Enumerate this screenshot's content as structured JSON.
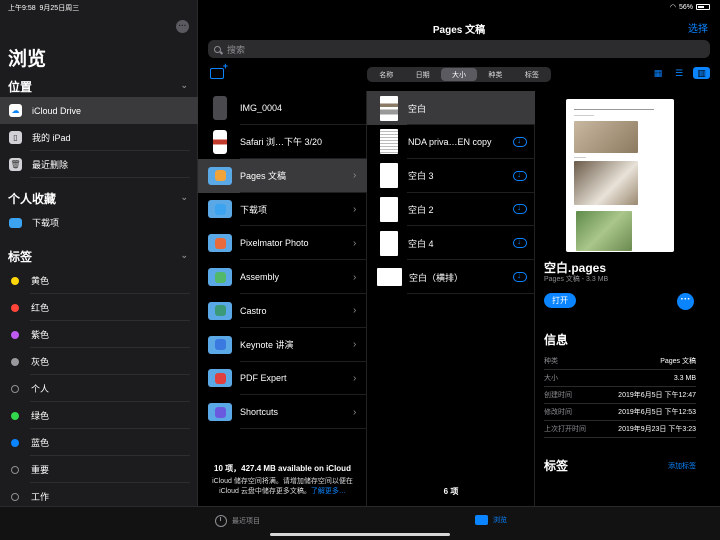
{
  "status": {
    "time": "上午9:58",
    "date": "9月25日周三",
    "battery": "56%"
  },
  "sidebar": {
    "title": "浏览",
    "locations_header": "位置",
    "locations": [
      {
        "label": "iCloud Drive",
        "icon": "icloud-icon"
      },
      {
        "label": "我的 iPad",
        "icon": "ipad-icon"
      },
      {
        "label": "最近删除",
        "icon": "trash-icon"
      }
    ],
    "favorites_header": "个人收藏",
    "favorites": [
      {
        "label": "下载项",
        "icon": "folder-icon"
      }
    ],
    "tags_header": "标签",
    "tags": [
      {
        "label": "黄色",
        "color": "#ffd60a"
      },
      {
        "label": "红色",
        "color": "#ff453a"
      },
      {
        "label": "紫色",
        "color": "#bf5af2"
      },
      {
        "label": "灰色",
        "color": "#98989d"
      },
      {
        "label": "个人",
        "color": ""
      },
      {
        "label": "绿色",
        "color": "#32d74b"
      },
      {
        "label": "蓝色",
        "color": "#0a84ff"
      },
      {
        "label": "重要",
        "color": ""
      },
      {
        "label": "工作",
        "color": ""
      }
    ]
  },
  "header": {
    "title": "Pages 文稿",
    "select": "选择",
    "search_placeholder": "搜索"
  },
  "sort": {
    "options": [
      "名称",
      "日期",
      "大小",
      "种类",
      "标签"
    ],
    "active": 2
  },
  "column1": {
    "items": [
      {
        "label": "IMG_0004",
        "type": "image"
      },
      {
        "label": "Safari 浏…下午 3/20",
        "type": "image"
      },
      {
        "label": "Pages 文稿",
        "type": "folder",
        "color": "#f2a33a"
      },
      {
        "label": "下载项",
        "type": "folder",
        "color": "#3ca3f0"
      },
      {
        "label": "Pixelmator Photo",
        "type": "folder",
        "color": "#e86a3a"
      },
      {
        "label": "Assembly",
        "type": "folder",
        "color": "#52b86a"
      },
      {
        "label": "Castro",
        "type": "folder",
        "color": "#3a9a7a"
      },
      {
        "label": "Keynote 讲演",
        "type": "folder",
        "color": "#3a7ae0"
      },
      {
        "label": "PDF Expert",
        "type": "folder",
        "color": "#e04040"
      },
      {
        "label": "Shortcuts",
        "type": "folder",
        "color": "#6a5ae0"
      }
    ],
    "selected": 2,
    "footer_count": "10 项，427.4 MB available on iCloud",
    "footer_note": "iCloud 储存空间将满。请增加储存空间以便在",
    "footer_note2": "iCloud 云盘中储存更多文稿。",
    "footer_link": "了解更多…"
  },
  "column2": {
    "items": [
      {
        "label": "空白",
        "cloud": false,
        "landscape": false
      },
      {
        "label": "NDA priva…EN copy",
        "cloud": true,
        "landscape": false
      },
      {
        "label": "空白 3",
        "cloud": true,
        "landscape": false
      },
      {
        "label": "空白 2",
        "cloud": true,
        "landscape": false
      },
      {
        "label": "空白 4",
        "cloud": true,
        "landscape": false
      },
      {
        "label": "空白（横排）",
        "cloud": true,
        "landscape": true
      }
    ],
    "selected": 0,
    "count": "6 项"
  },
  "detail": {
    "name": "空白.pages",
    "subtitle": "Pages 文稿 - 3.3 MB",
    "open": "打开",
    "info_header": "信息",
    "info": [
      {
        "k": "种类",
        "v": "Pages 文稿"
      },
      {
        "k": "大小",
        "v": "3.3 MB"
      },
      {
        "k": "创建时间",
        "v": "2019年6月5日 下午12:47"
      },
      {
        "k": "修改时间",
        "v": "2019年6月5日 下午12:53"
      },
      {
        "k": "上次打开时间",
        "v": "2019年9月23日 下午3:23"
      }
    ],
    "tags_header": "标签",
    "add_tags": "添加标签"
  },
  "tabbar": {
    "recents": "最近项目",
    "browse": "浏览"
  }
}
